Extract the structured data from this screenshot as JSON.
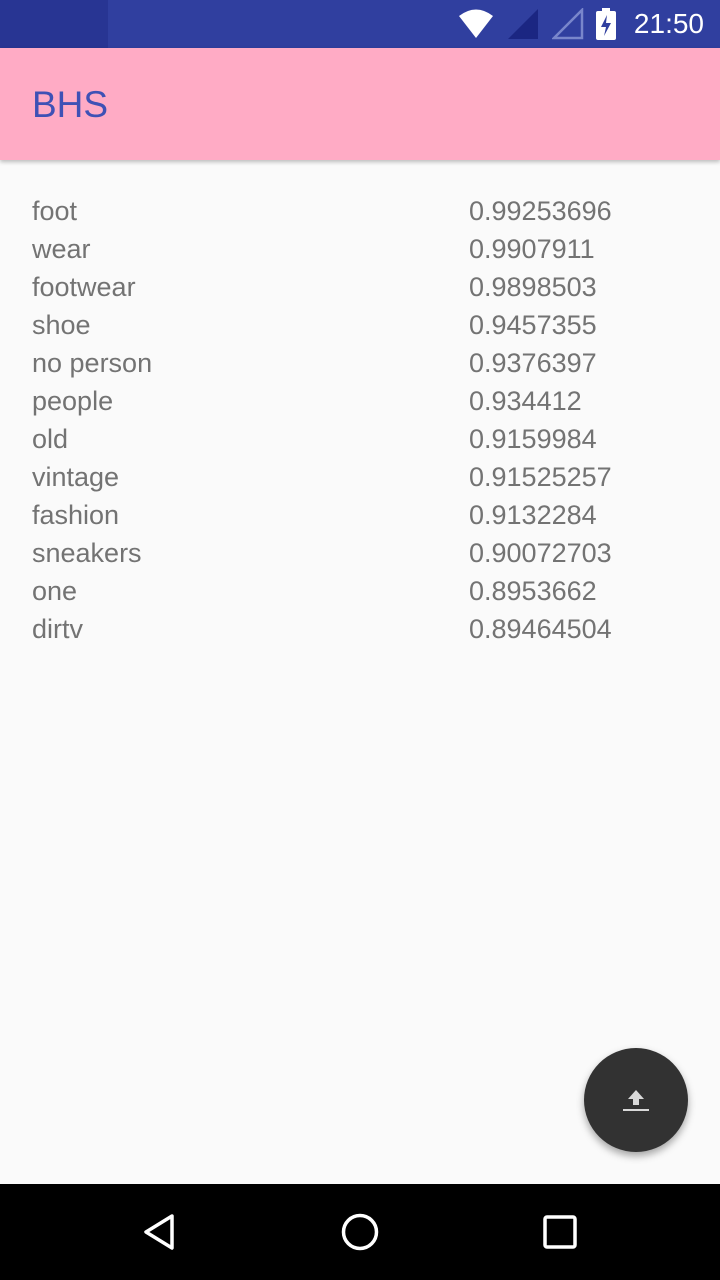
{
  "status_bar": {
    "time": "21:50",
    "icons": [
      "wifi-icon",
      "signal-icon",
      "signal-empty-icon",
      "battery-charging-icon"
    ]
  },
  "app_bar": {
    "title": "BHS"
  },
  "labels": [
    {
      "name": "foot",
      "score": "0.99253696"
    },
    {
      "name": "wear",
      "score": "0.9907911"
    },
    {
      "name": "footwear",
      "score": "0.9898503"
    },
    {
      "name": "shoe",
      "score": "0.9457355"
    },
    {
      "name": "no person",
      "score": "0.9376397"
    },
    {
      "name": "people",
      "score": "0.934412"
    },
    {
      "name": "old",
      "score": "0.9159984"
    },
    {
      "name": "vintage",
      "score": "0.91525257"
    },
    {
      "name": "fashion",
      "score": "0.9132284"
    },
    {
      "name": "sneakers",
      "score": "0.90072703"
    },
    {
      "name": "one",
      "score": "0.8953662"
    },
    {
      "name": "dirtv",
      "score": "0.89464504"
    }
  ],
  "fab": {
    "icon": "upload-icon"
  },
  "nav_bar": {
    "icons": [
      "back-icon",
      "home-icon",
      "recents-icon"
    ]
  },
  "colors": {
    "status_bar": "#303f9f",
    "app_bar": "#ffabc5",
    "title": "#3f51b5",
    "text": "#737373",
    "fab": "#323232"
  }
}
